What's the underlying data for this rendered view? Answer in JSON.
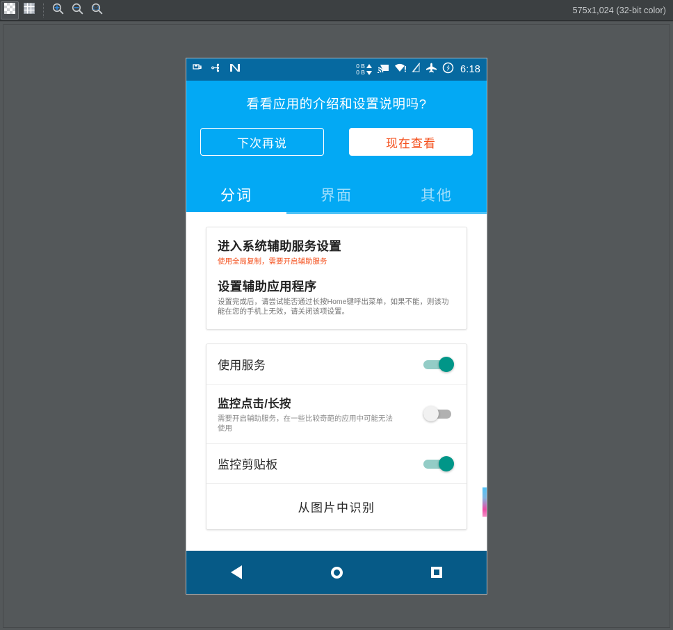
{
  "viewer": {
    "toolbar": {
      "buttons": [
        {
          "name": "transparency-checker-toggle",
          "icon": "checkerboard-icon",
          "active": true
        },
        {
          "name": "pixel-grid-toggle",
          "icon": "grid-icon",
          "active": false
        },
        {
          "name": "zoom-in-button",
          "icon": "zoom-in-icon",
          "active": false
        },
        {
          "name": "zoom-out-button",
          "icon": "zoom-out-icon",
          "active": false
        },
        {
          "name": "zoom-actual-size-button",
          "icon": "zoom-1to1-icon",
          "active": false
        }
      ]
    },
    "size_label": "575x1,024  (32-bit color)"
  },
  "phone": {
    "status_bar": {
      "left_icons": [
        "sd-card-icon",
        "usb-debug-icon",
        "app-logo-icon"
      ],
      "data_usage": {
        "up": "0 B",
        "down": "0 B"
      },
      "right_icons": [
        "cast-icon",
        "wifi-alert-icon",
        "signal-off-icon",
        "airplane-mode-icon",
        "sync-icon"
      ],
      "clock": "6:18"
    },
    "promo": {
      "message": "看看应用的介绍和设置说明吗?",
      "later_label": "下次再说",
      "now_label": "现在查看"
    },
    "tabs": [
      {
        "label": "分词",
        "selected": true
      },
      {
        "label": "界面",
        "selected": false
      },
      {
        "label": "其他",
        "selected": false
      }
    ],
    "card_1": {
      "item_1": {
        "title": "进入系统辅助服务设置",
        "subtitle": "使用全局复制，需要开启辅助服务"
      },
      "item_2": {
        "title": "设置辅助应用程序",
        "subtitle": "设置完成后，请尝试能否通过长按Home键呼出菜单，如果不能，则该功能在您的手机上无效，请关闭该项设置。"
      }
    },
    "card_2": {
      "rows": [
        {
          "title": "使用服务",
          "subtitle": "",
          "switch": "on"
        },
        {
          "title": "监控点击/长按",
          "subtitle": "需要开启辅助服务，在一些比较奇葩的应用中可能无法使用",
          "switch": "off"
        },
        {
          "title": "监控剪贴板",
          "subtitle": "",
          "switch": "on"
        }
      ],
      "action_label": "从图片中识别"
    },
    "nav_bar": {
      "back": "back-icon",
      "home": "home-icon",
      "recents": "recents-icon"
    }
  },
  "colors": {
    "header_blue": "#03a9f4",
    "status_blue": "#0669a0",
    "nav_blue": "#065a87",
    "accent_orange": "#f4511e",
    "switch_on": "#009688",
    "switch_off": "#b1b1b1",
    "app_chrome": "#3c4042",
    "canvas_bg": "#54585a"
  }
}
